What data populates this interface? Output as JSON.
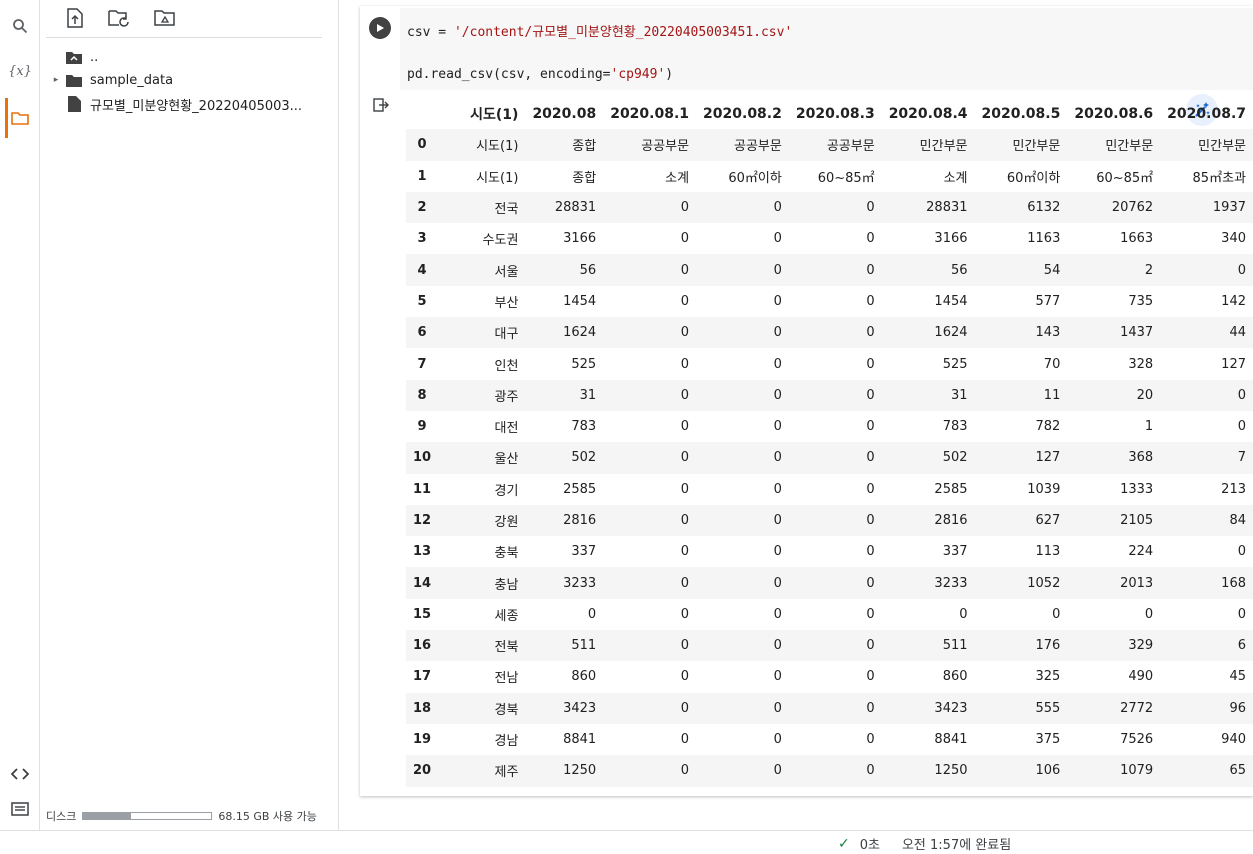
{
  "sidebar": {
    "icons": [
      "search-icon",
      "variables-icon",
      "folder-icon",
      "code-snippets-icon",
      "terminal-icon"
    ],
    "variables_label": "{x}",
    "tree": [
      {
        "label": "..",
        "type": "parent"
      },
      {
        "label": "sample_data",
        "type": "folder"
      },
      {
        "label": "규모별_미분양현황_20220405003...",
        "type": "file"
      }
    ],
    "disk_label": "디스크",
    "disk_available": "68.15 GB 사용 가능",
    "disk_used_fraction": 0.37
  },
  "cell": {
    "code_line1_prefix": "csv = ",
    "code_line1_string": "'/content/규모별_미분양현황_20220405003451.csv'",
    "code_line2_prefix": "pd.read_csv(csv, encoding=",
    "code_line2_string": "'cp949'",
    "code_line2_suffix": ")"
  },
  "table": {
    "columns": [
      "시도(1)",
      "2020.08",
      "2020.08.1",
      "2020.08.2",
      "2020.08.3",
      "2020.08.4",
      "2020.08.5",
      "2020.08.6",
      "2020.08.7"
    ],
    "rows": [
      [
        "0",
        "시도(1)",
        "종합",
        "공공부문",
        "공공부문",
        "공공부문",
        "민간부문",
        "민간부문",
        "민간부문",
        "민간부문"
      ],
      [
        "1",
        "시도(1)",
        "종합",
        "소계",
        "60㎡이하",
        "60~85㎡",
        "소계",
        "60㎡이하",
        "60~85㎡",
        "85㎡초과"
      ],
      [
        "2",
        "전국",
        "28831",
        "0",
        "0",
        "0",
        "28831",
        "6132",
        "20762",
        "1937"
      ],
      [
        "3",
        "수도권",
        "3166",
        "0",
        "0",
        "0",
        "3166",
        "1163",
        "1663",
        "340"
      ],
      [
        "4",
        "서울",
        "56",
        "0",
        "0",
        "0",
        "56",
        "54",
        "2",
        "0"
      ],
      [
        "5",
        "부산",
        "1454",
        "0",
        "0",
        "0",
        "1454",
        "577",
        "735",
        "142"
      ],
      [
        "6",
        "대구",
        "1624",
        "0",
        "0",
        "0",
        "1624",
        "143",
        "1437",
        "44"
      ],
      [
        "7",
        "인천",
        "525",
        "0",
        "0",
        "0",
        "525",
        "70",
        "328",
        "127"
      ],
      [
        "8",
        "광주",
        "31",
        "0",
        "0",
        "0",
        "31",
        "11",
        "20",
        "0"
      ],
      [
        "9",
        "대전",
        "783",
        "0",
        "0",
        "0",
        "783",
        "782",
        "1",
        "0"
      ],
      [
        "10",
        "울산",
        "502",
        "0",
        "0",
        "0",
        "502",
        "127",
        "368",
        "7"
      ],
      [
        "11",
        "경기",
        "2585",
        "0",
        "0",
        "0",
        "2585",
        "1039",
        "1333",
        "213"
      ],
      [
        "12",
        "강원",
        "2816",
        "0",
        "0",
        "0",
        "2816",
        "627",
        "2105",
        "84"
      ],
      [
        "13",
        "충북",
        "337",
        "0",
        "0",
        "0",
        "337",
        "113",
        "224",
        "0"
      ],
      [
        "14",
        "충남",
        "3233",
        "0",
        "0",
        "0",
        "3233",
        "1052",
        "2013",
        "168"
      ],
      [
        "15",
        "세종",
        "0",
        "0",
        "0",
        "0",
        "0",
        "0",
        "0",
        "0"
      ],
      [
        "16",
        "전북",
        "511",
        "0",
        "0",
        "0",
        "511",
        "176",
        "329",
        "6"
      ],
      [
        "17",
        "전남",
        "860",
        "0",
        "0",
        "0",
        "860",
        "325",
        "490",
        "45"
      ],
      [
        "18",
        "경북",
        "3423",
        "0",
        "0",
        "0",
        "3423",
        "555",
        "2772",
        "96"
      ],
      [
        "19",
        "경남",
        "8841",
        "0",
        "0",
        "0",
        "8841",
        "375",
        "7526",
        "940"
      ],
      [
        "20",
        "제주",
        "1250",
        "0",
        "0",
        "0",
        "1250",
        "106",
        "1079",
        "65"
      ]
    ]
  },
  "status": {
    "duration": "0초",
    "completed": "오전 1:57에 완료됨"
  },
  "colors": {
    "accent": "#e8710a",
    "run_button": "#424242",
    "string": "#a31515",
    "success": "#188038"
  }
}
